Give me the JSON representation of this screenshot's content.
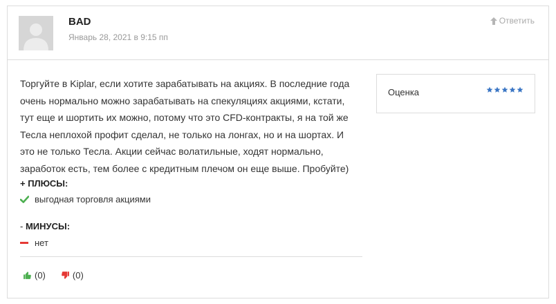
{
  "review": {
    "author": "BAD",
    "date": "Январь 28, 2021 в 9:15 пп",
    "reply_label": "Ответить",
    "body": "Торгуйте в Kiplar, если хотите зарабатывать на акциях. В последние года очень нормально можно зарабатывать на спекуляциях акциями, кстати, тут еще и шортить их можно, потому что это CFD-контракты, я на той же Тесла неплохой профит сделал, не только на лонгах, но и на шортах. И это не только Тесла. Акции сейчас волатильные, ходят нормально, заработок есть, тем более с кредитным плечом он еще выше. Пробуйте)"
  },
  "rating": {
    "label": "Оценка",
    "stars": 5,
    "max_stars": 5,
    "star_color": "#3b76c4"
  },
  "pros": {
    "title": "+ ПЛЮСЫ:",
    "items": [
      "выгодная торговля акциями"
    ],
    "icon": "check-icon",
    "color": "#4caf50"
  },
  "cons": {
    "title_prefix": "-",
    "title": "МИНУСЫ:",
    "items": [
      "нет"
    ],
    "icon": "minus-icon",
    "color": "#e53935"
  },
  "votes": {
    "up": "(0)",
    "down": "(0)",
    "up_color": "#4caf50",
    "down_color": "#e53935"
  }
}
